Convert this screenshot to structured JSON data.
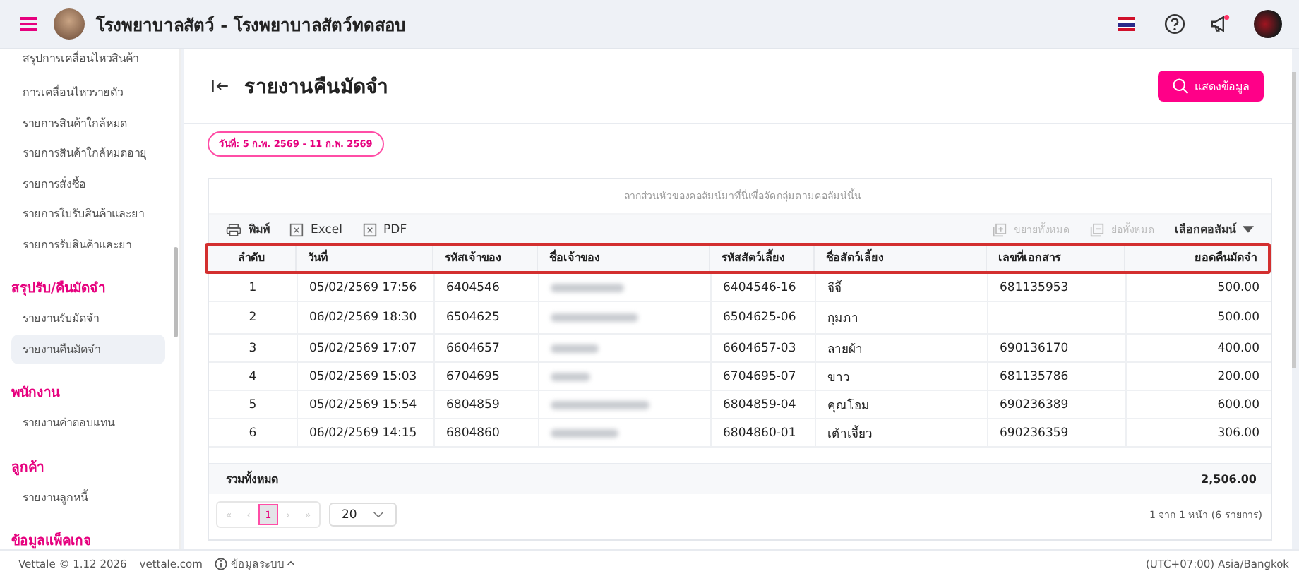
{
  "topbar": {
    "title": "โรงพยาบาลสัตว์ - โรงพยาบาลสัตว์ทดสอบ"
  },
  "sidebar": {
    "items": [
      {
        "kind": "item",
        "label": "สรุปการเคลื่อนไหวสินค้า",
        "selected": false
      },
      {
        "kind": "item",
        "label": "การเคลื่อนไหวรายตัว",
        "selected": false
      },
      {
        "kind": "item",
        "label": "รายการสินค้าใกล้หมด",
        "selected": false
      },
      {
        "kind": "item",
        "label": "รายการสินค้าใกล้หมดอายุ",
        "selected": false
      },
      {
        "kind": "item",
        "label": "รายการสั่งซื้อ",
        "selected": false
      },
      {
        "kind": "item",
        "label": "รายการใบรับสินค้าและยา",
        "selected": false
      },
      {
        "kind": "item",
        "label": "รายการรับสินค้าและยา",
        "selected": false
      },
      {
        "kind": "section",
        "label": "สรุปรับ/คืนมัดจำ"
      },
      {
        "kind": "item",
        "label": "รายงานรับมัดจำ",
        "selected": false
      },
      {
        "kind": "item",
        "label": "รายงานคืนมัดจำ",
        "selected": true
      },
      {
        "kind": "section",
        "label": "พนักงาน"
      },
      {
        "kind": "item",
        "label": "รายงานค่าตอบแทน",
        "selected": false
      },
      {
        "kind": "section",
        "label": "ลูกค้า"
      },
      {
        "kind": "item",
        "label": "รายงานลูกหนี้",
        "selected": false
      },
      {
        "kind": "section",
        "label": "ข้อมูลแพ็คเกจ"
      }
    ]
  },
  "page": {
    "title": "รายงานคืนมัดจำ",
    "show_button": "แสดงข้อมูล",
    "date_chip": "วันที่: 5 ก.พ. 2569 - 11 ก.พ. 2569"
  },
  "grid": {
    "group_hint": "ลากส่วนหัวของคอลัมน์มาที่นี่เพื่อจัดกลุ่มตามคอลัมน์นั้น",
    "toolbar": [
      {
        "kind": "print",
        "label": "พิมพ์"
      },
      {
        "kind": "excel",
        "label": "Excel"
      },
      {
        "kind": "pdf",
        "label": "PDF"
      }
    ],
    "toolbar_right": [
      {
        "kind": "expand",
        "label": "ขยายทั้งหมด",
        "disabled": true
      },
      {
        "kind": "collapse",
        "label": "ย่อทั้งหมด",
        "disabled": true
      },
      {
        "kind": "columns",
        "label": "เลือกคอลัมน์",
        "disabled": false
      }
    ],
    "columns": [
      {
        "label": "ลำดับ"
      },
      {
        "label": "วันที่"
      },
      {
        "label": "รหัสเจ้าของ"
      },
      {
        "label": "ชื่อเจ้าของ"
      },
      {
        "label": "รหัสสัตว์เลี้ยง"
      },
      {
        "label": "ชื่อสัตว์เลี้ยง"
      },
      {
        "label": "เลขที่เอกสาร"
      },
      {
        "label": "ยอดคืนมัดจำ"
      }
    ],
    "rows": [
      {
        "cells": [
          "1",
          "05/02/2569 17:56",
          "6404546",
          null,
          "6404546-16",
          "จีจี้",
          "681135953",
          "500.00"
        ]
      },
      {
        "cells": [
          "2",
          "06/02/2569 18:30",
          "6504625",
          null,
          "6504625-06",
          "กุมภา",
          null,
          "500.00"
        ]
      },
      {
        "cells": [
          "3",
          "05/02/2569 17:07",
          "6604657",
          null,
          "6604657-03",
          "ลายผ้า",
          "690136170",
          "400.00"
        ]
      },
      {
        "cells": [
          "4",
          "05/02/2569 15:03",
          "6704695",
          null,
          "6704695-07",
          "ขาว",
          "681135786",
          "200.00"
        ]
      },
      {
        "cells": [
          "5",
          "05/02/2569 15:54",
          "6804859",
          null,
          "6804859-04",
          "คุณโอม",
          "690236389",
          "600.00"
        ]
      },
      {
        "cells": [
          "6",
          "06/02/2569 14:15",
          "6804860",
          null,
          "6804860-01",
          "เต้าเจี้ยว",
          "690236359",
          "306.00"
        ]
      }
    ],
    "total_label": "รวมทั้งหมด",
    "total_value": "2,506.00",
    "pager": {
      "buttons": [
        {
          "label": "«",
          "disabled": true,
          "selected": false
        },
        {
          "label": "‹",
          "disabled": true,
          "selected": false
        },
        {
          "label": "1",
          "disabled": false,
          "selected": true
        },
        {
          "label": "›",
          "disabled": true,
          "selected": false
        },
        {
          "label": "»",
          "disabled": true,
          "selected": false
        }
      ],
      "page_size": "20",
      "info": "1 จาก 1 หน้า (6 รายการ)"
    }
  },
  "footer": {
    "brand": "Vettale © 1.12 2026",
    "link": "vettale.com",
    "system_info": "ข้อมูลระบบ",
    "timezone": "(UTC+07:00) Asia/Bangkok"
  }
}
